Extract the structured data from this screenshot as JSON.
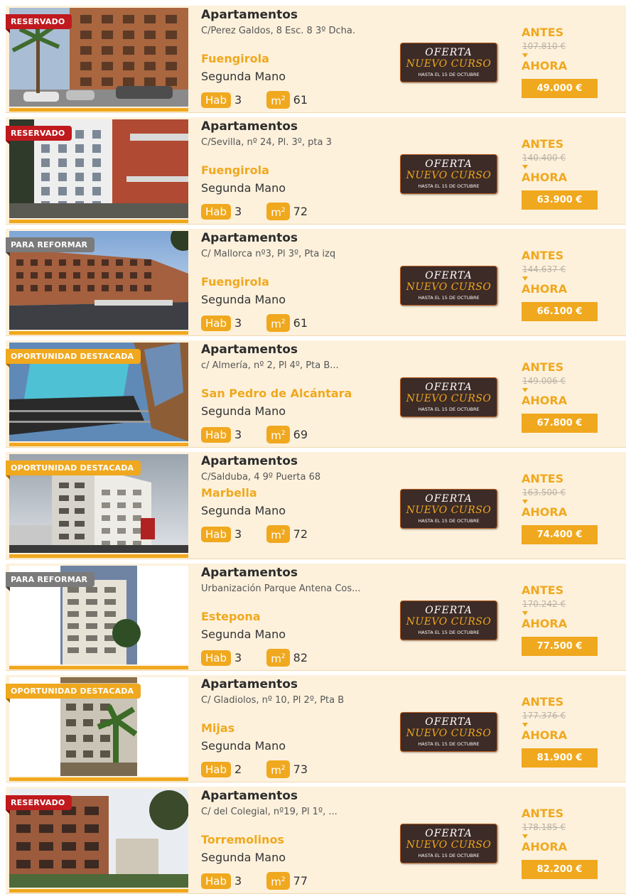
{
  "colors": {
    "accent": "#f0a81e",
    "row_bg": "#fdf1dc",
    "reservado": "#c0191e",
    "para_reformar": "#7b7b7b",
    "oportunidad": "#f0a81e",
    "offer_board": "#3c2b27"
  },
  "offer_badge": {
    "line1": "OFERTA",
    "line2": "NUEVO CURSO",
    "line3": "HASTA EL 15 DE OCTUBRE"
  },
  "labels": {
    "antes": "ANTES",
    "ahora": "AHORA",
    "hab": "Hab",
    "m2_base": "m",
    "m2_sup": "2"
  },
  "listings": [
    {
      "ribbon": "RESERVADO",
      "ribbon_type": "reservado",
      "property_type": "Apartamentos",
      "address": "C/Perez Galdos, 8 Esc. 8 3º Dcha.",
      "city": "Fuengirola",
      "condition": "Segunda Mano",
      "rooms": "3",
      "area": "61",
      "old_price": "107.810 €",
      "new_price": "49.000 €",
      "scene": "palm"
    },
    {
      "ribbon": "RESERVADO",
      "ribbon_type": "reservado",
      "property_type": "Apartamentos",
      "address": "C/Sevilla, nº 24, Pl. 3º, pta 3",
      "city": "Fuengirola",
      "condition": "Segunda Mano",
      "rooms": "3",
      "area": "72",
      "old_price": "140.400 €",
      "new_price": "63.900 €",
      "scene": "white"
    },
    {
      "ribbon": "PARA REFORMAR",
      "ribbon_type": "para_reformar",
      "property_type": "Apartamentos",
      "address": "C/ Mallorca nº3, Pl 3º, Pta izq",
      "city": "Fuengirola",
      "condition": "Segunda Mano",
      "rooms": "3",
      "area": "61",
      "old_price": "144.637 €",
      "new_price": "66.100 €",
      "scene": "street"
    },
    {
      "ribbon": "OPORTUNIDAD DESTACADA",
      "ribbon_type": "oportunidad",
      "property_type": "Apartamentos",
      "address": "c/ Almería, nº 2, Pl 4º, Pta B...",
      "city": "San Pedro de Alcántara",
      "condition": "Segunda Mano",
      "rooms": "3",
      "area": "69",
      "old_price": "149.006 €",
      "new_price": "67.800 €",
      "scene": "balcony"
    },
    {
      "ribbon": "OPORTUNIDAD DESTACADA",
      "ribbon_type": "oportunidad",
      "property_type": "Apartamentos",
      "address": "C/Salduba, 4 9º Puerta 68",
      "city": "Marbella",
      "condition": "Segunda Mano",
      "rooms": "3",
      "area": "72",
      "old_price": "163.500 €",
      "new_price": "74.400 €",
      "scene": "tower"
    },
    {
      "ribbon": "PARA REFORMAR",
      "ribbon_type": "para_reformar",
      "property_type": "Apartamentos",
      "address": "Urbanización Parque Antena Cos...",
      "city": "Estepona",
      "condition": "Segunda Mano",
      "rooms": "3",
      "area": "82",
      "old_price": "170.242 €",
      "new_price": "77.500 €",
      "scene": "narrow"
    },
    {
      "ribbon": "OPORTUNIDAD DESTACADA",
      "ribbon_type": "oportunidad",
      "property_type": "Apartamentos",
      "address": "C/ Gladiolos, nº 10, Pl 2º, Pta B",
      "city": "Mijas",
      "condition": "Segunda Mano",
      "rooms": "2",
      "area": "73",
      "old_price": "177.376 €",
      "new_price": "81.900 €",
      "scene": "banana"
    },
    {
      "ribbon": "RESERVADO",
      "ribbon_type": "reservado",
      "property_type": "Apartamentos",
      "address": "C/ del Colegial, nº19, Pl 1º, ...",
      "city": "Torremolinos",
      "condition": "Segunda Mano",
      "rooms": "3",
      "area": "77",
      "old_price": "178.185 €",
      "new_price": "82.200 €",
      "scene": "terrace"
    }
  ]
}
